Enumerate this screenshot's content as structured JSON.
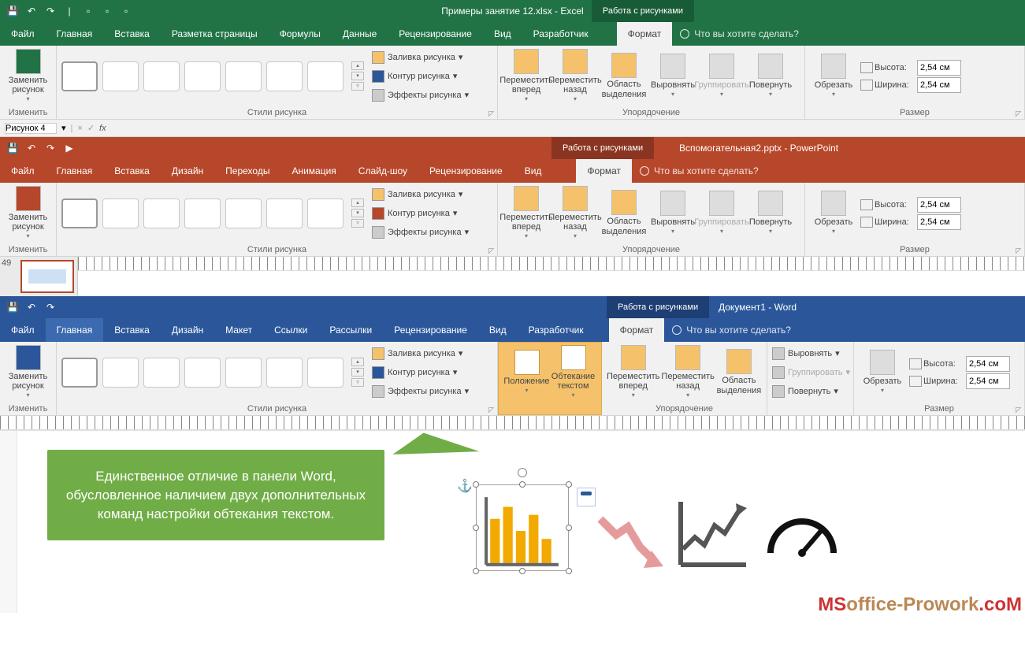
{
  "common": {
    "contextual_tab": "Работа с рисунками",
    "format_tab": "Формат",
    "tell_me": "Что вы хотите сделать?",
    "replace_pic": "Заменить рисунок",
    "change_group": "Изменить",
    "pic_styles": "Стили рисунка",
    "fill": "Заливка рисунка",
    "outline": "Контур рисунка",
    "effects": "Эффекты рисунка",
    "bring_forward": "Переместить вперед",
    "send_backward": "Переместить назад",
    "selection_pane": "Область выделения",
    "align": "Выровнять",
    "group_cmd": "Группировать",
    "rotate": "Повернуть",
    "arrange": "Упорядочение",
    "crop": "Обрезать",
    "height_lbl": "Высота:",
    "width_lbl": "Ширина:",
    "size_val": "2,54 см",
    "size_group": "Размер"
  },
  "excel": {
    "title": "Примеры занятие 12.xlsx  -  Excel",
    "tabs": [
      "Файл",
      "Главная",
      "Вставка",
      "Разметка страницы",
      "Формулы",
      "Данные",
      "Рецензирование",
      "Вид",
      "Разработчик"
    ],
    "namebox": "Рисунок 4"
  },
  "ppt": {
    "title": "Вспомогательная2.pptx  -  PowerPoint",
    "tabs": [
      "Файл",
      "Главная",
      "Вставка",
      "Дизайн",
      "Переходы",
      "Анимация",
      "Слайд-шоу",
      "Рецензирование",
      "Вид"
    ],
    "slide_num": "49"
  },
  "word": {
    "title": "Документ1  -  Word",
    "tabs": [
      "Файл",
      "Главная",
      "Вставка",
      "Дизайн",
      "Макет",
      "Ссылки",
      "Рассылки",
      "Рецензирование",
      "Вид",
      "Разработчик"
    ],
    "position": "Положение",
    "wrap": "Обтекание текстом"
  },
  "callout": "Единственное отличие в панели Word, обусловленное наличием двух дополнительных команд настройки обтекания текстом.",
  "watermark": "MSoffice-Prowork.com"
}
